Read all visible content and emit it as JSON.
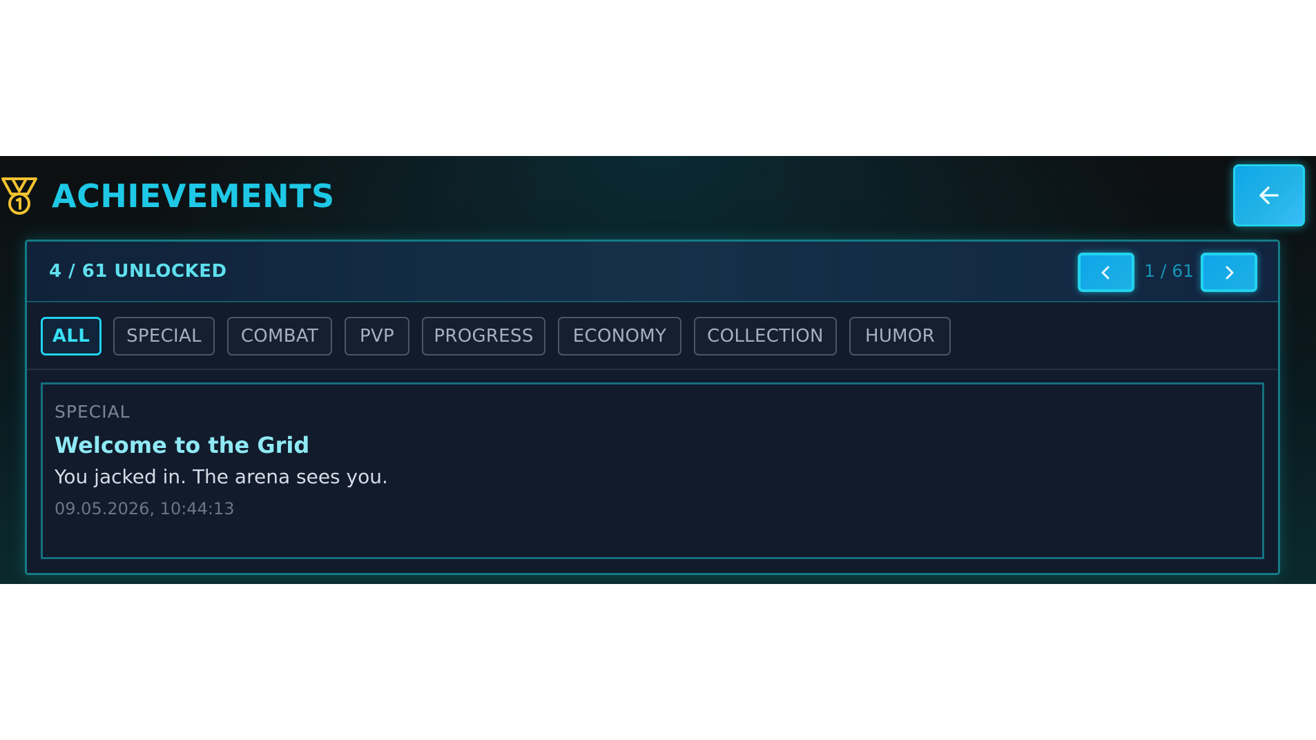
{
  "header": {
    "title": "ACHIEVEMENTS",
    "icon": "medal-icon",
    "back_icon": "arrow-left-icon"
  },
  "panel": {
    "unlock_summary": "4 / 61 UNLOCKED",
    "pager": {
      "indicator": "1 / 61",
      "prev_icon": "chevron-left-icon",
      "next_icon": "chevron-right-icon"
    },
    "filters": [
      {
        "label": "ALL",
        "active": true
      },
      {
        "label": "SPECIAL",
        "active": false
      },
      {
        "label": "COMBAT",
        "active": false
      },
      {
        "label": "PVP",
        "active": false
      },
      {
        "label": "PROGRESS",
        "active": false
      },
      {
        "label": "ECONOMY",
        "active": false
      },
      {
        "label": "COLLECTION",
        "active": false
      },
      {
        "label": "HUMOR",
        "active": false
      }
    ],
    "achievement": {
      "category": "SPECIAL",
      "title": "Welcome to the Grid",
      "description": "You jacked in. The arena sees you.",
      "unlocked_at": "09.05.2026, 10:44:13"
    }
  },
  "colors": {
    "accent": "#22d3ee",
    "title": "#1ec8e6",
    "medal": "#f2c230",
    "panel_bg": "#111b2c",
    "panel_border": "#147c86"
  }
}
